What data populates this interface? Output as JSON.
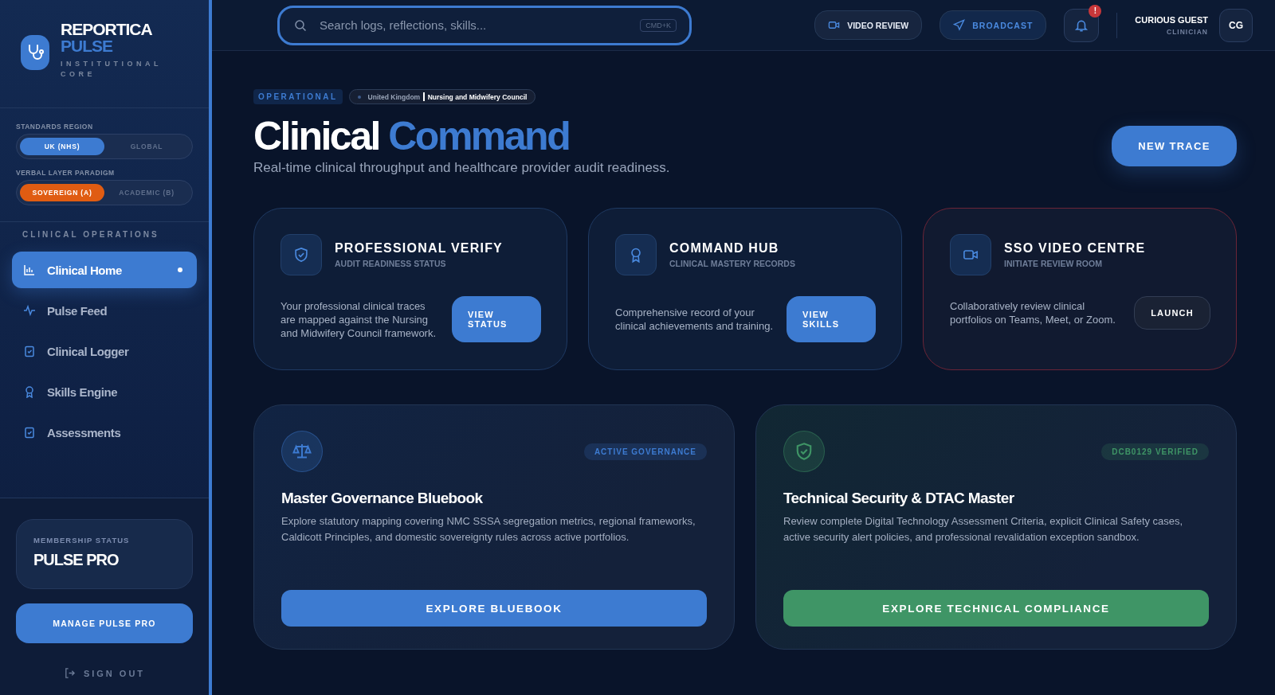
{
  "sidebar": {
    "brand": {
      "title": "REPORTICA",
      "subtitle": "PULSE",
      "tagline": "INSTITUTIONAL CORE"
    },
    "standards_region": {
      "label": "STANDARDS REGION",
      "options": [
        {
          "label": "UK (NHS)",
          "selected": true
        },
        {
          "label": "GLOBAL",
          "selected": false
        }
      ]
    },
    "verbal_layer": {
      "label": "VERBAL LAYER PARADIGM",
      "options": [
        {
          "label": "SOVEREIGN (A)",
          "selected": true
        },
        {
          "label": "ACADEMIC (B)",
          "selected": false
        }
      ]
    },
    "section": "CLINICAL OPERATIONS",
    "items": [
      {
        "label": "Clinical Home",
        "selected": true
      },
      {
        "label": "Pulse Feed",
        "selected": false
      },
      {
        "label": "Clinical Logger",
        "selected": false
      },
      {
        "label": "Skills Engine",
        "selected": false
      },
      {
        "label": "Assessments",
        "selected": false
      }
    ],
    "membership": {
      "label": "MEMBERSHIP STATUS",
      "value": "PULSE PRO"
    },
    "manage_button": "MANAGE PULSE PRO",
    "sign_out": "SIGN OUT"
  },
  "header": {
    "search": {
      "placeholder": "Search logs, reflections, skills...",
      "shortcut": "CMD+K"
    },
    "video_review": "VIDEO REVIEW",
    "broadcast": "BROADCAST",
    "notification_badge": "!",
    "user": {
      "name": "CURIOUS GUEST",
      "role": "CLINICIAN",
      "initials": "CG"
    }
  },
  "hero": {
    "status": "OPERATIONAL",
    "region": "United Kingdom",
    "council": "Nursing and Midwifery Council",
    "title_main": "Clinical",
    "title_accent": "Command",
    "subtitle": "Real-time clinical throughput and healthcare provider audit readiness.",
    "action": "NEW TRACE"
  },
  "cards": [
    {
      "kind": "standard",
      "title": "PROFESSIONAL VERIFY",
      "subtitle": "AUDIT READINESS STATUS",
      "text": "Your professional clinical traces are mapped against the Nursing and Midwifery Council framework.",
      "button": "VIEW STATUS"
    },
    {
      "kind": "standard",
      "title": "COMMAND HUB",
      "subtitle": "CLINICAL MASTERY RECORDS",
      "text": "Comprehensive record of your clinical achievements and training.",
      "button": "VIEW SKILLS"
    },
    {
      "kind": "alert",
      "title": "SSO VIDEO CENTRE",
      "subtitle": "INITIATE REVIEW ROOM",
      "text": "Collaboratively review clinical portfolios on Teams, Meet, or Zoom.",
      "button": "LAUNCH"
    }
  ],
  "features": [
    {
      "color": "#3d7bd1",
      "badge": "ACTIVE GOVERNANCE",
      "title": "Master Governance Bluebook",
      "text": "Explore statutory mapping covering NMC SSSA segregation metrics, regional frameworks, Caldicott Principles, and domestic sovereignty rules across active portfolios.",
      "button": "EXPLORE BLUEBOOK"
    },
    {
      "color": "#3f9566",
      "badge": "DCB0129 VERIFIED",
      "title": "Technical Security & DTAC Master",
      "text": "Review complete Digital Technology Assessment Criteria, explicit Clinical Safety cases, active security alert policies, and professional revalidation exception sandbox.",
      "button": "EXPLORE TECHNICAL COMPLIANCE"
    }
  ]
}
